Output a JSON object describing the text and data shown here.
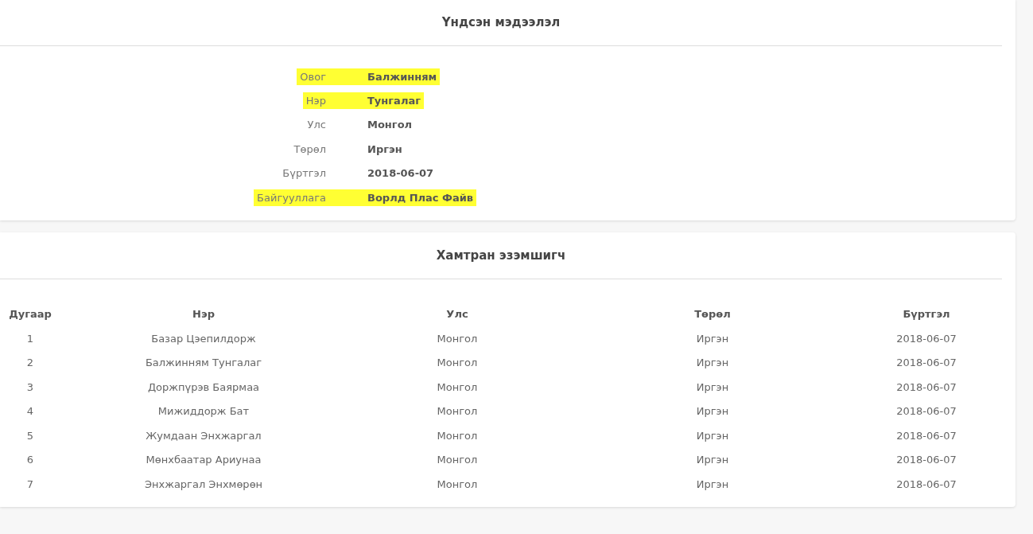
{
  "basic_info": {
    "title": "Үндсэн мэдээлэл",
    "fields": [
      {
        "label": "Овог",
        "value": "Балжинням",
        "highlighted": true
      },
      {
        "label": "Нэр",
        "value": "Тунгалаг",
        "highlighted": true
      },
      {
        "label": "Улс",
        "value": "Монгол",
        "highlighted": false
      },
      {
        "label": "Төрөл",
        "value": "Иргэн",
        "highlighted": false
      },
      {
        "label": "Бүртгэл",
        "value": "2018-06-07",
        "highlighted": false
      },
      {
        "label": "Байгууллага",
        "value": "Ворлд Плас Файв",
        "highlighted": true
      }
    ]
  },
  "co_owners": {
    "title": "Хамтран эзэмшигч",
    "columns": [
      "Дугаар",
      "Нэр",
      "Улс",
      "Төрөл",
      "Бүртгэл"
    ],
    "rows": [
      [
        "1",
        "Базар Цэепилдорж",
        "Монгол",
        "Иргэн",
        "2018-06-07"
      ],
      [
        "2",
        "Балжинням Тунгалаг",
        "Монгол",
        "Иргэн",
        "2018-06-07"
      ],
      [
        "3",
        "Доржпүрэв Баярмаа",
        "Монгол",
        "Иргэн",
        "2018-06-07"
      ],
      [
        "4",
        "Мижиддорж Бат",
        "Монгол",
        "Иргэн",
        "2018-06-07"
      ],
      [
        "5",
        "Жумдаан Энхжаргал",
        "Монгол",
        "Иргэн",
        "2018-06-07"
      ],
      [
        "6",
        "Мөнхбаатар Ариунаа",
        "Монгол",
        "Иргэн",
        "2018-06-07"
      ],
      [
        "7",
        "Энхжаргал Энхмөрөн",
        "Монгол",
        "Иргэн",
        "2018-06-07"
      ]
    ]
  }
}
